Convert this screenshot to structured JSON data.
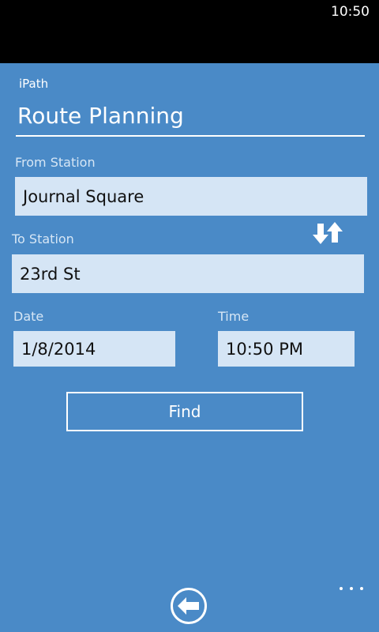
{
  "status_bar": {
    "time": "10:50"
  },
  "app": {
    "name": "iPath"
  },
  "page": {
    "title": "Route Planning"
  },
  "form": {
    "from_label": "From Station",
    "from_value": "Journal Square",
    "to_label": "To Station",
    "to_value": "23rd St",
    "date_label": "Date",
    "date_value": "1/8/2014",
    "time_label": "Time",
    "time_value": "10:50 PM",
    "find_label": "Find"
  },
  "icons": {
    "swap": "swap-stations-icon",
    "back": "back-arrow-icon",
    "more": "ellipsis-icon"
  },
  "colors": {
    "background": "#4a8ac7",
    "field": "#d5e5f5",
    "status_bar": "#000000"
  }
}
